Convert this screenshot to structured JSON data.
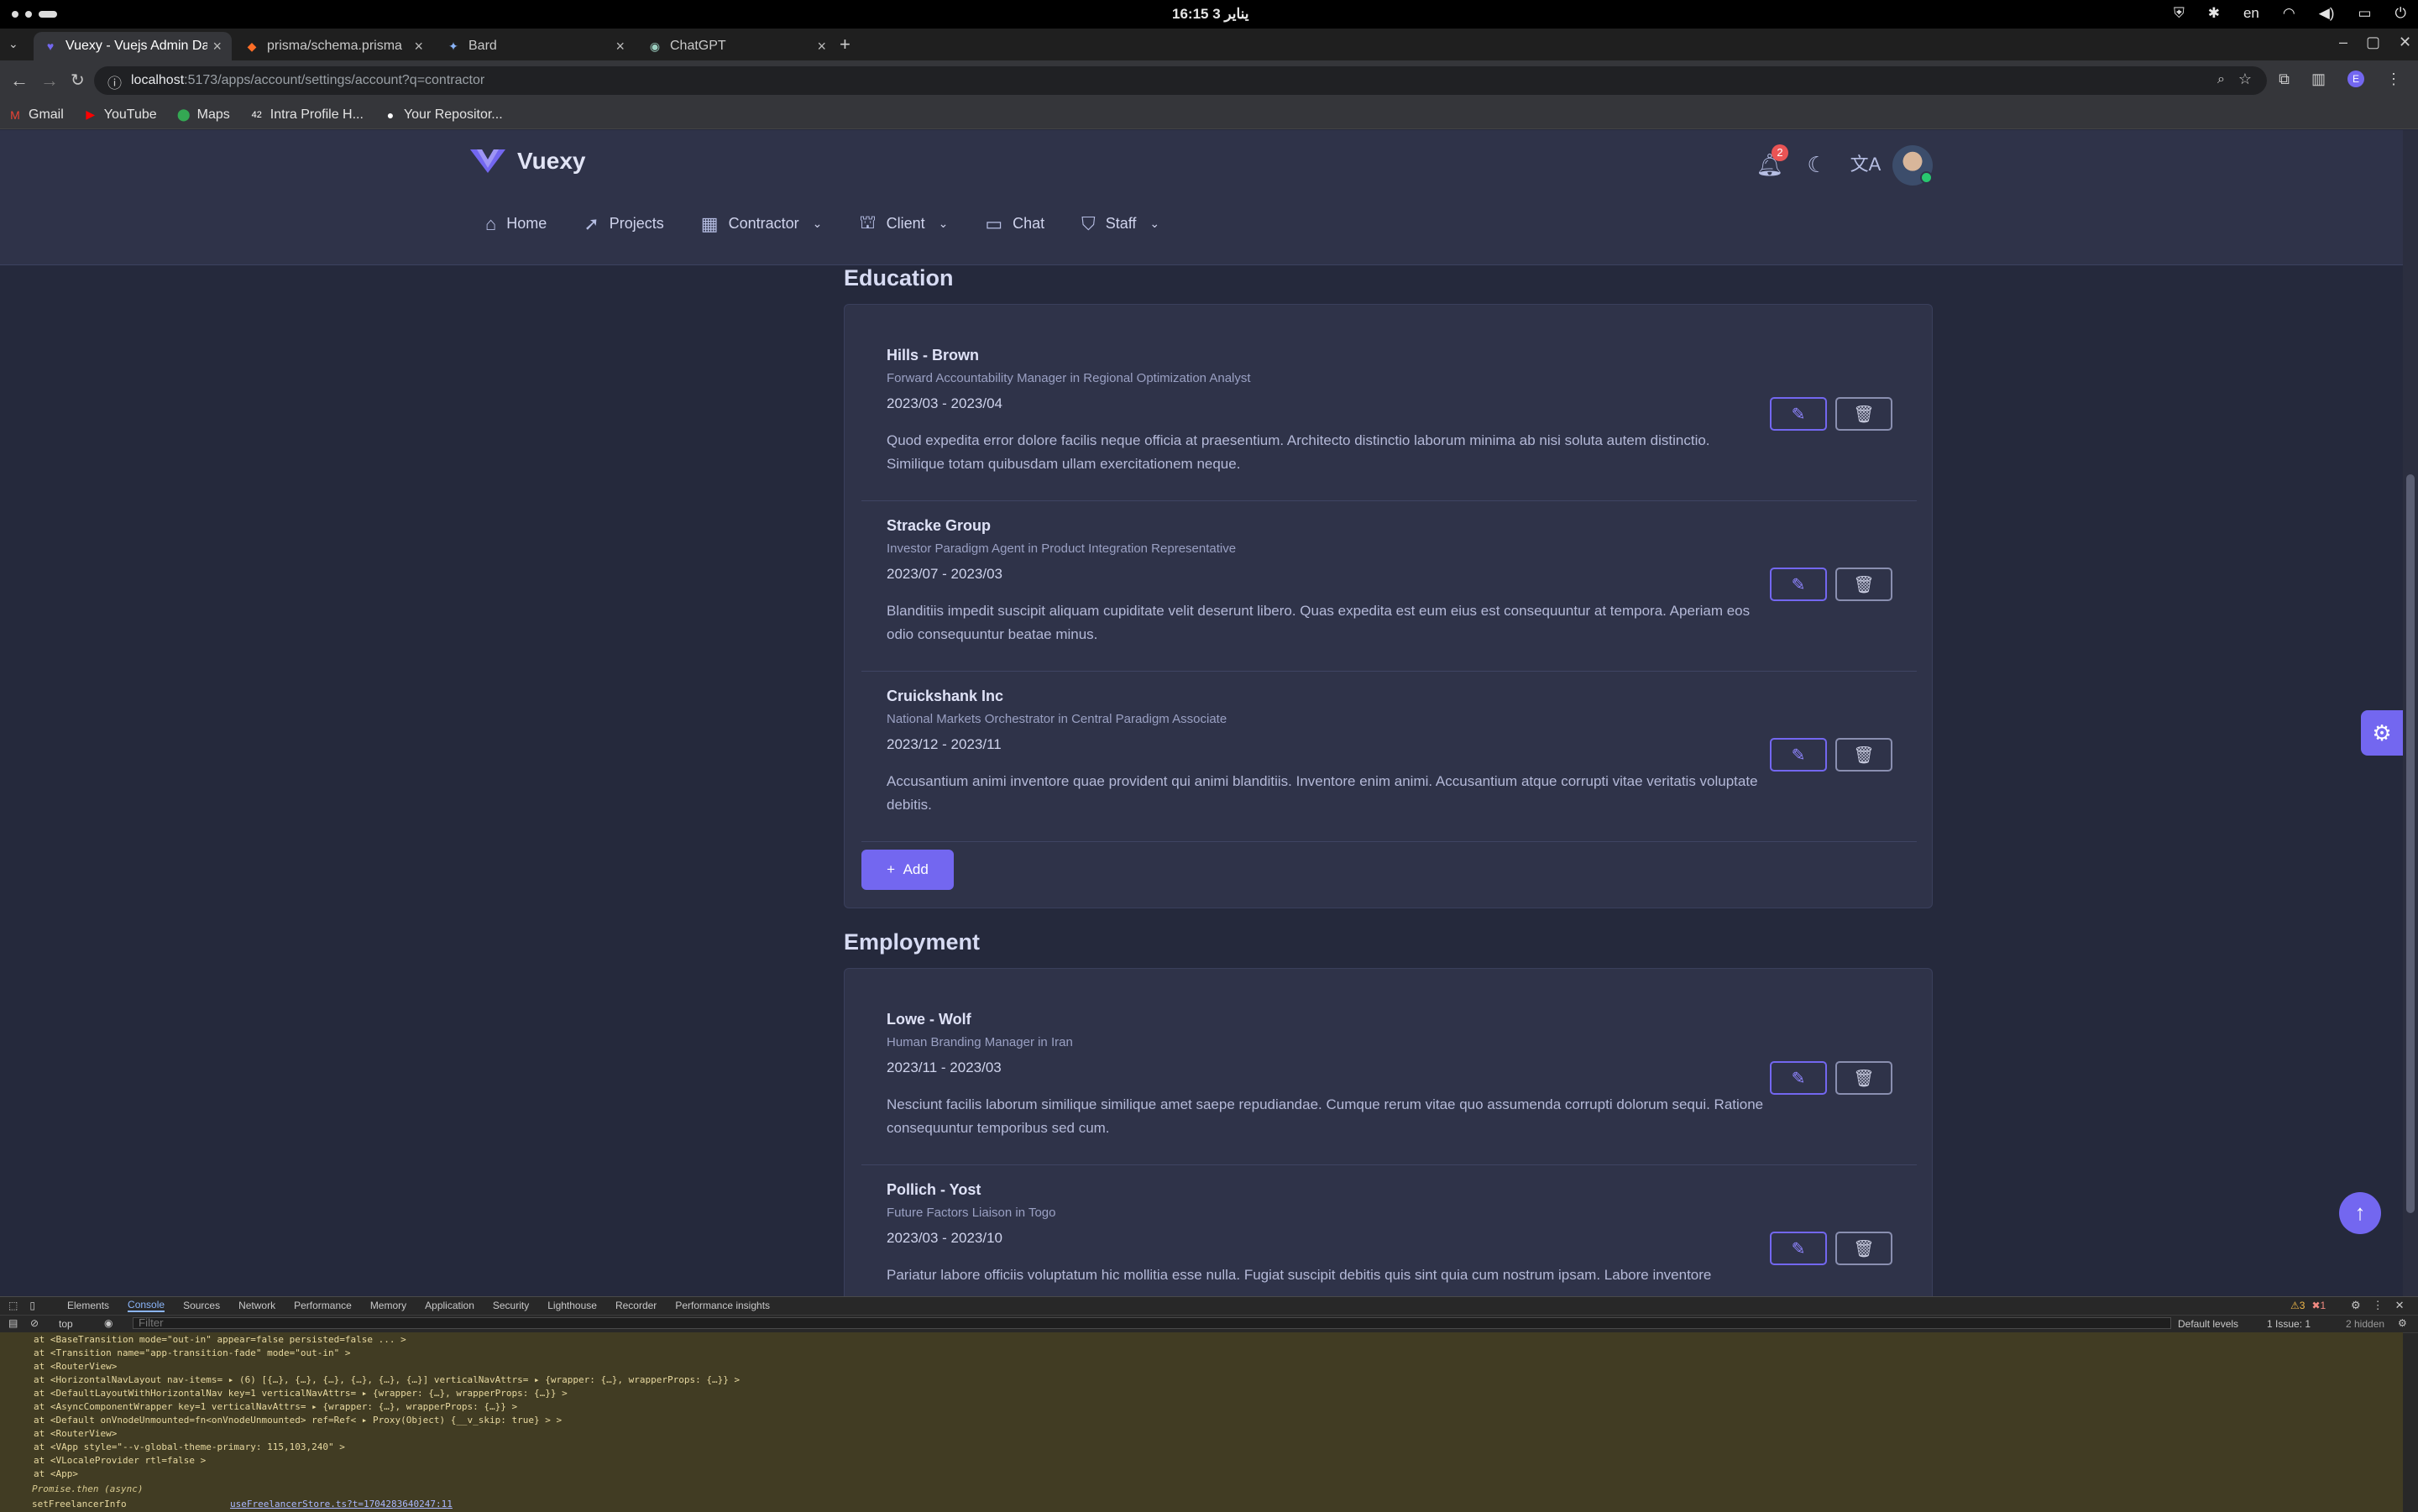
{
  "os": {
    "clock": "16:15 3 يناير",
    "lang": "en"
  },
  "tabs": [
    {
      "title": "Vuexy - Vuejs Admin Da",
      "icon": "vuexy-icon",
      "active": true
    },
    {
      "title": "prisma/schema.prisma",
      "icon": "gitlab-icon",
      "active": false
    },
    {
      "title": "Bard",
      "icon": "bard-icon",
      "active": false
    },
    {
      "title": "ChatGPT",
      "icon": "chatgpt-icon",
      "active": false
    }
  ],
  "omnibox": {
    "host": "localhost",
    "path": ":5173/apps/account/settings/account?q=contractor"
  },
  "bookmarks": [
    "Gmail",
    "YouTube",
    "Maps",
    "Intra Profile H...",
    "Your Repositor..."
  ],
  "app": {
    "brand": "Vuexy",
    "notifications": "2",
    "menu": [
      "Home",
      "Projects",
      "Contractor",
      "Client",
      "Chat",
      "Staff"
    ]
  },
  "education": {
    "title": "Education",
    "items": [
      {
        "company": "Hills - Brown",
        "role": "Forward Accountability Manager in Regional Optimization Analyst",
        "dates": "2023/03 - 2023/04",
        "desc": "Quod expedita error dolore facilis neque officia at praesentium. Architecto distinctio laborum minima ab nisi soluta autem distinctio. Similique totam quibusdam ullam exercitationem neque."
      },
      {
        "company": "Stracke Group",
        "role": "Investor Paradigm Agent in Product Integration Representative",
        "dates": "2023/07 - 2023/03",
        "desc": "Blanditiis impedit suscipit aliquam cupiditate velit deserunt libero. Quas expedita est eum eius est consequuntur at tempora. Aperiam eos odio consequuntur beatae minus."
      },
      {
        "company": "Cruickshank Inc",
        "role": "National Markets Orchestrator in Central Paradigm Associate",
        "dates": "2023/12 - 2023/11",
        "desc": "Accusantium animi inventore quae provident qui animi blanditiis. Inventore enim animi. Accusantium atque corrupti vitae veritatis voluptate debitis."
      }
    ],
    "add_label": "Add"
  },
  "employment": {
    "title": "Employment",
    "items": [
      {
        "company": "Lowe - Wolf",
        "role": "Human Branding Manager in Iran",
        "dates": "2023/11 - 2023/03",
        "desc": "Nesciunt facilis laborum similique similique amet saepe repudiandae. Cumque rerum vitae quo assumenda corrupti dolorum sequi. Ratione consequuntur temporibus sed cum."
      },
      {
        "company": "Pollich - Yost",
        "role": "Future Factors Liaison in Togo",
        "dates": "2023/03 - 2023/10",
        "desc": "Pariatur labore officiis voluptatum hic mollitia esse nulla. Fugiat suscipit debitis quis sint quia cum nostrum ipsam. Labore inventore"
      }
    ]
  },
  "devtools": {
    "tabs": [
      "Elements",
      "Console",
      "Sources",
      "Network",
      "Performance",
      "Memory",
      "Application",
      "Security",
      "Lighthouse",
      "Recorder",
      "Performance insights"
    ],
    "context": "top",
    "filter_placeholder": "Filter",
    "levels": "Default levels",
    "issues": "1 Issue: 1",
    "hidden": "2 hidden",
    "warn_count": "3",
    "err_count": "1",
    "log": [
      "at <BaseTransition mode=\"out-in\" appear=false persisted=false  ... >",
      "at <Transition name=\"app-transition-fade\" mode=\"out-in\" >",
      "at <RouterView>",
      "at <HorizontalNavLayout nav-items= ▸ (6) [{…}, {…}, {…}, {…}, {…}, {…}] verticalNavAttrs= ▸ {wrapper: {…}, wrapperProps: {…}} >",
      "at <DefaultLayoutWithHorizontalNav key=1 verticalNavAttrs= ▸ {wrapper: {…}, wrapperProps: {…}} >",
      "at <AsyncComponentWrapper key=1 verticalNavAttrs= ▸ {wrapper: {…}, wrapperProps: {…}} >",
      "at <Default onVnodeUnmounted=fn<onVnodeUnmounted> ref=Ref< ▸ Proxy(Object) {__v_skip: true} > >",
      "at <RouterView>",
      "at <VApp style=\"--v-global-theme-primary: 115,103,240\" >",
      "at <VLocaleProvider rtl=false >",
      "at <App>"
    ],
    "promise": "Promise.then (async)",
    "source_fn": "setFreelancerInfo",
    "source_link": "useFreelancerStore.ts?t=1704283640247:11"
  }
}
